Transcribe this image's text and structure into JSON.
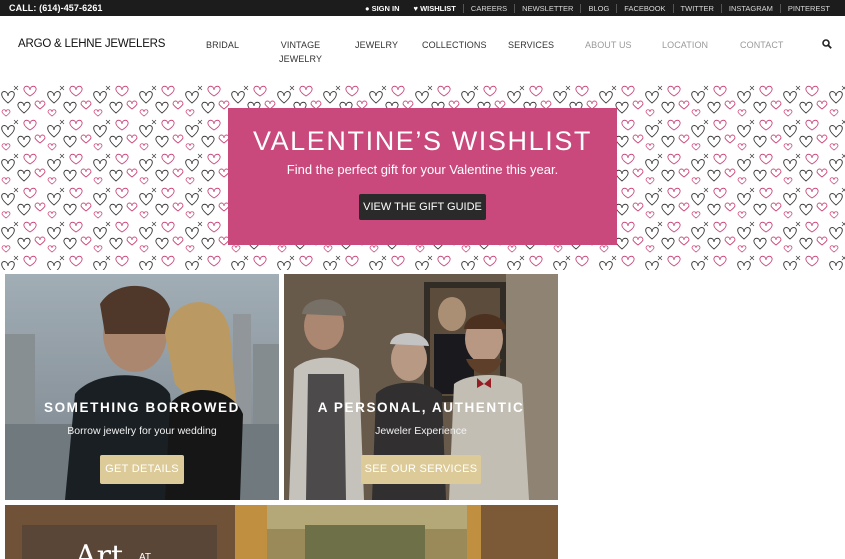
{
  "topbar": {
    "call": "CALL: (614)-457-6261",
    "sign_in": "SIGN IN",
    "wishlist": "WISHLIST",
    "links": [
      "CAREERS",
      "NEWSLETTER",
      "BLOG",
      "FACEBOOK",
      "TWITTER",
      "INSTAGRAM",
      "PINTEREST"
    ]
  },
  "header": {
    "logo": "ARGO & LEHNE JEWELERS",
    "nav": {
      "bridal": "BRIDAL",
      "vintage_1": "VINTAGE",
      "vintage_2": "JEWELRY",
      "jewelry": "JEWELRY",
      "collections": "COLLECTIONS",
      "services": "SERVICES",
      "about": "ABOUT US",
      "location": "LOCATION",
      "contact": "CONTACT"
    },
    "search_icon": "search-icon"
  },
  "hero": {
    "title": "VALENTINE’S WISHLIST",
    "subtitle": "Find the perfect gift for your Valentine this year.",
    "button": "VIEW THE GIFT GUIDE",
    "colors": {
      "box": "#c9497d",
      "heart_dark": "#3a3a3a",
      "heart_pink": "#c9497d"
    }
  },
  "tiles": [
    {
      "title": "SOMETHING BORROWED",
      "subtitle": "Borrow jewelry for your wedding",
      "button": "GET DETAILS"
    },
    {
      "title": "A PERSONAL, AUTHENTIC",
      "subtitle": "Jeweler Experience",
      "button": "SEE OUR SERVICES"
    },
    {
      "title": "Art",
      "subtitle": "AT"
    }
  ],
  "accent_colors": {
    "tile_button": "#dccb98"
  }
}
